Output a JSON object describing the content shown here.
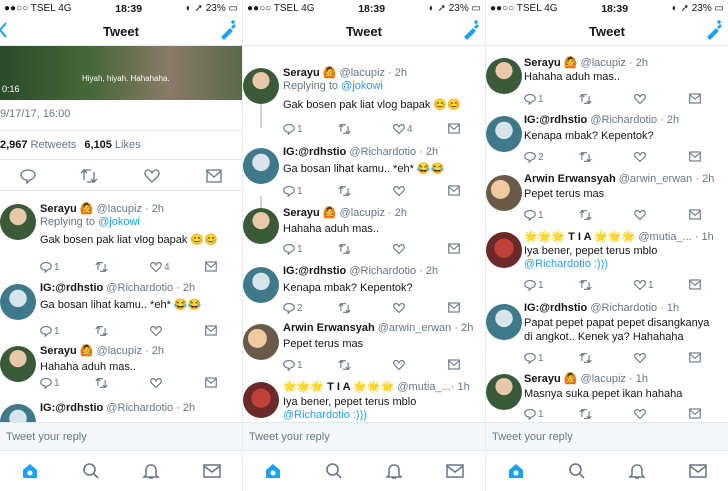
{
  "status_bars": [
    {
      "carrier": "TSEL",
      "net": "4G",
      "time": "18:39",
      "battery": "23%"
    },
    {
      "carrier": "TSEL",
      "net": "4G",
      "time": "18:39",
      "battery": "23%"
    },
    {
      "carrier": "TSEL",
      "net": "4G",
      "time": "18:39",
      "battery": "23%"
    }
  ],
  "nav_title": "Tweet",
  "reply_placeholder": "Tweet your reply",
  "panel1": {
    "video_caption": "Hiyah, hiyah. Hahahaha.",
    "video_time": "0:16",
    "date": "9/17/17, 16:00",
    "retweets_count": "2,967",
    "retweets_label": "Retweets",
    "likes_count": "6,105",
    "likes_label": "Likes",
    "tweets": [
      {
        "name": "Serayu",
        "emoji": "🙆",
        "handle": "@lacupiz · 2h",
        "replying": "Replying to",
        "replying_to": "@jokowi",
        "text": "Gak bosen pak liat vlog bapak 😊😊",
        "replies": "1",
        "likes": "4"
      },
      {
        "name": "IG:@rdhstio",
        "handle": "@Richardotio · 2h",
        "text": "Ga bosan lihat kamu.. *eh* 😂😂",
        "replies": "1"
      },
      {
        "name": "Serayu",
        "emoji": "🙆",
        "handle": "@lacupiz · 2h",
        "text": "Hahaha aduh mas..",
        "replies": "1"
      },
      {
        "name": "IG:@rdhstio",
        "handle": "@Richardotio · 2h"
      }
    ]
  },
  "panel2": {
    "tweets": [
      {
        "name": "Serayu",
        "emoji": "🙆",
        "handle": "@lacupiz · 2h",
        "replying": "Replying to",
        "replying_to": "@jokowi",
        "text": "Gak bosen pak liat vlog bapak 😊😊",
        "replies": "1",
        "likes": "4"
      },
      {
        "name": "IG:@rdhstio",
        "handle": "@Richardotio · 2h",
        "text": "Ga bosan lihat kamu.. *eh* 😂😂",
        "replies": "1"
      },
      {
        "name": "Serayu",
        "emoji": "🙆",
        "handle": "@lacupiz · 2h",
        "text": "Hahaha aduh mas..",
        "replies": "1"
      },
      {
        "name": "IG:@rdhstio",
        "handle": "@Richardotio · 2h",
        "text": "Kenapa mbak? Kepentok?",
        "replies": "2"
      },
      {
        "name": "Arwin Erwansyah",
        "handle": "@arwin_erwan · 2h",
        "text": "Pepet terus mas",
        "replies": "1"
      },
      {
        "name": "🌟🌟🌟 T I A 🌟🌟🌟",
        "handle": "@mutia_...· 1h",
        "text": "Iya bener, pepet terus mblo",
        "mention": "@Richardotio :)))"
      }
    ]
  },
  "panel3": {
    "tweets": [
      {
        "name": "Serayu",
        "emoji": "🙆",
        "handle": "@lacupiz · 2h",
        "text": "Hahaha aduh mas..",
        "replies": "1"
      },
      {
        "name": "IG:@rdhstio",
        "handle": "@Richardotio · 2h",
        "text": "Kenapa mbak? Kepentok?",
        "replies": "2"
      },
      {
        "name": "Arwin Erwansyah",
        "handle": "@arwin_erwan · 2h",
        "text": "Pepet terus mas",
        "replies": "1"
      },
      {
        "name": "🌟🌟🌟 T I A 🌟🌟🌟",
        "handle": "@mutia_... · 1h",
        "text": "Iya bener, pepet terus mblo",
        "mention": "@Richardotio :)))",
        "replies": "1",
        "likes": "1"
      },
      {
        "name": "IG:@rdhstio",
        "handle": "@Richardotio · 1h",
        "text": "Papat pepet papat pepet disangkanya",
        "text2": "di angkot.. Kenek ya? Hahahaha",
        "replies": "1"
      },
      {
        "name": "Serayu",
        "emoji": "🙆",
        "handle": "@lacupiz · 1h",
        "text": "Masnya suka pepet ikan hahaha",
        "replies": "1"
      }
    ]
  },
  "colors": {
    "accent": "#1da1f2",
    "muted": "#657786",
    "border": "#e1e8ed"
  },
  "icons": [
    "reply-icon",
    "retweet-icon",
    "like-icon",
    "dm-icon",
    "home-icon",
    "search-icon",
    "notifications-icon",
    "messages-icon",
    "compose-icon",
    "back-icon"
  ]
}
